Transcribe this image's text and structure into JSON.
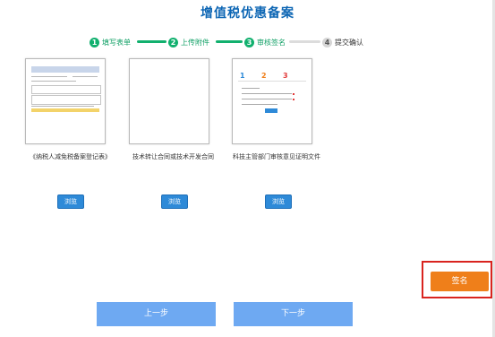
{
  "page": {
    "title": "增值税优惠备案"
  },
  "steps": [
    {
      "num": "1",
      "label": "填写表单",
      "state": "done"
    },
    {
      "num": "2",
      "label": "上传附件",
      "state": "done"
    },
    {
      "num": "3",
      "label": "审核签名",
      "state": "current"
    },
    {
      "num": "4",
      "label": "提交确认",
      "state": "pending"
    }
  ],
  "documents": [
    {
      "label": "《纳税人减免税备案登记表》",
      "browse_label": "浏览"
    },
    {
      "label": "技术转让合同或技术开发合同",
      "browse_label": "浏览"
    },
    {
      "label": "科技主管部门审核意见证明文件",
      "browse_label": "浏览"
    }
  ],
  "thumb3": {
    "nums": [
      "1",
      "2",
      "3"
    ]
  },
  "actions": {
    "sign_label": "签名",
    "prev_label": "上一步",
    "next_label": "下一步"
  },
  "colors": {
    "title": "#0d66b4",
    "step_done": "#11b06e",
    "browse": "#2e8ad8",
    "sign": "#ef7f1a",
    "nav": "#6ea9f2",
    "highlight": "#d9241f"
  }
}
